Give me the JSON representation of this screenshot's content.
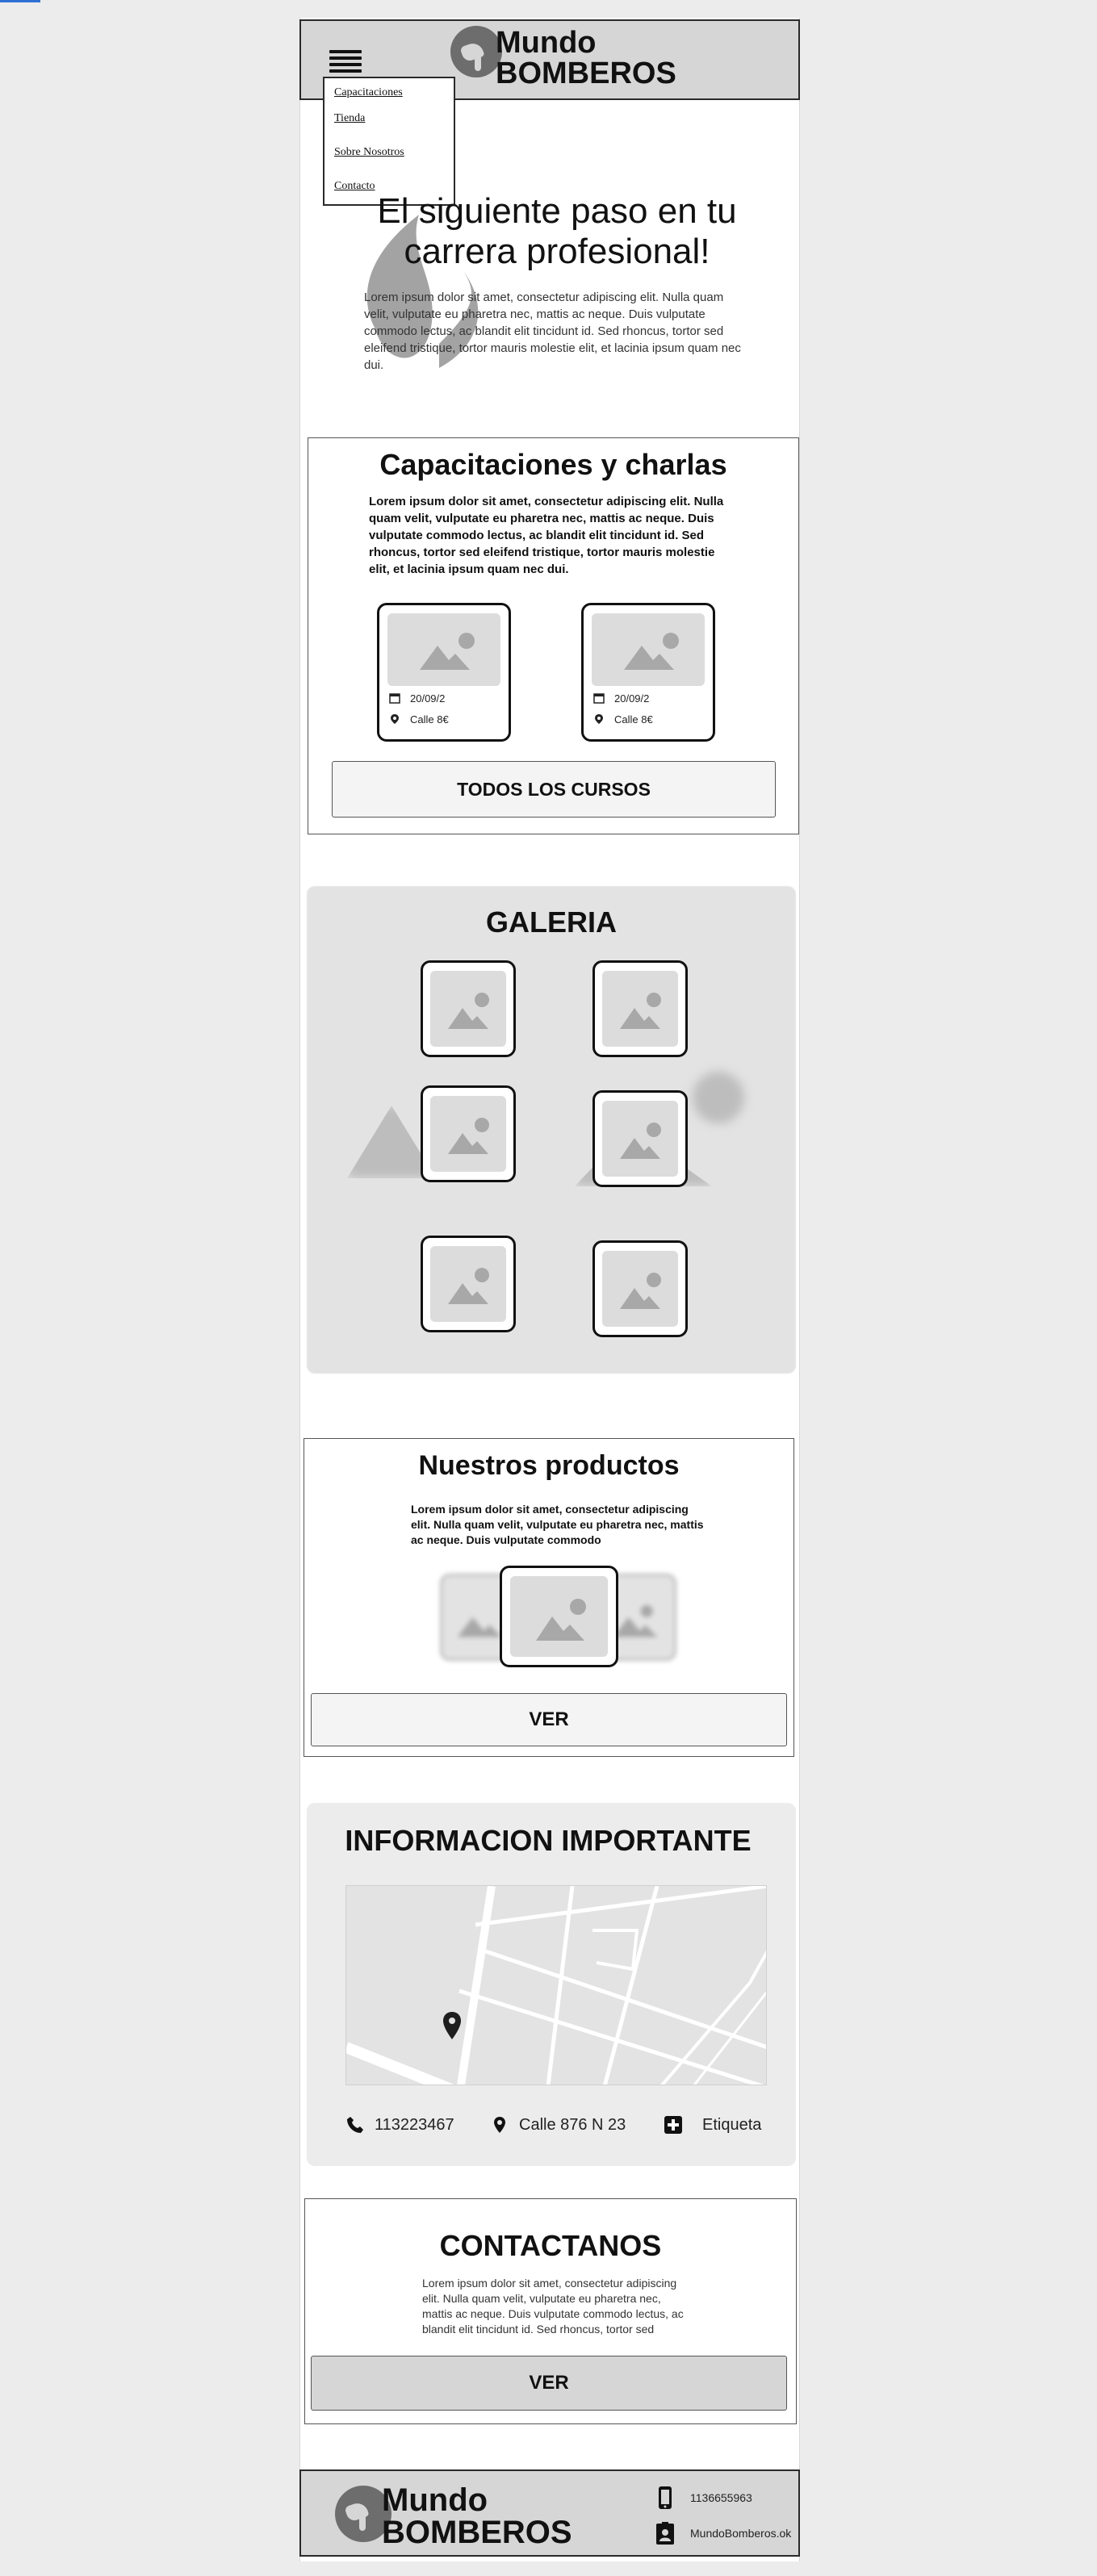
{
  "header": {
    "logo_line1": "Mundo",
    "logo_line2": "BOMBEROS",
    "menu_icon": "hamburger-menu-icon"
  },
  "nav": {
    "items": [
      "Capacitaciones",
      "Tienda",
      "Sobre Nosotros",
      "Contacto"
    ]
  },
  "hero": {
    "title": "El siguiente paso en tu carrera profesional!",
    "body": "Lorem ipsum dolor sit amet, consectetur adipiscing elit. Nulla quam velit, vulputate eu pharetra nec, mattis ac neque. Duis vulputate commodo lectus, ac blandit elit tincidunt id. Sed rhoncus, tortor sed eleifend tristique, tortor mauris molestie elit, et lacinia ipsum quam nec dui."
  },
  "courses": {
    "title": "Capacitaciones y charlas",
    "body": "Lorem ipsum dolor sit amet, consectetur adipiscing elit. Nulla quam velit, vulputate eu pharetra nec, mattis ac neque. Duis vulputate commodo lectus, ac blandit elit tincidunt id. Sed rhoncus, tortor sed eleifend tristique, tortor mauris molestie elit, et lacinia ipsum quam nec dui.",
    "cards": [
      {
        "date": "20/09/2",
        "place": "Calle 8€"
      },
      {
        "date": "20/09/2",
        "place": "Calle 8€"
      }
    ],
    "button": "TODOS LOS CURSOS"
  },
  "gallery": {
    "title": "GALERIA"
  },
  "products": {
    "title": "Nuestros productos",
    "body": "Lorem ipsum dolor sit amet, consectetur adipiscing elit. Nulla quam velit, vulputate eu pharetra nec, mattis ac neque. Duis vulputate commodo",
    "button": "VER"
  },
  "info": {
    "title": "INFORMACION IMPORTANTE",
    "phone": "113223467",
    "address": "Calle 876 N 23",
    "label": "Etiqueta"
  },
  "contact": {
    "title": "CONTACTANOS",
    "body": "Lorem ipsum dolor sit amet, consectetur adipiscing elit. Nulla quam velit, vulputate eu pharetra nec, mattis ac neque. Duis vulputate commodo lectus, ac blandit elit tincidunt id. Sed rhoncus, tortor sed",
    "button": "VER"
  },
  "footer": {
    "logo_line1": "Mundo",
    "logo_line2": "BOMBEROS",
    "phone": "1136655963",
    "account": "MundoBomberos.ok"
  },
  "colors": {
    "header_bg": "#d6d6d6",
    "page_bg": "#ececec",
    "placeholder": "#dcdcdc",
    "accent_line": "#2f6fd4"
  }
}
